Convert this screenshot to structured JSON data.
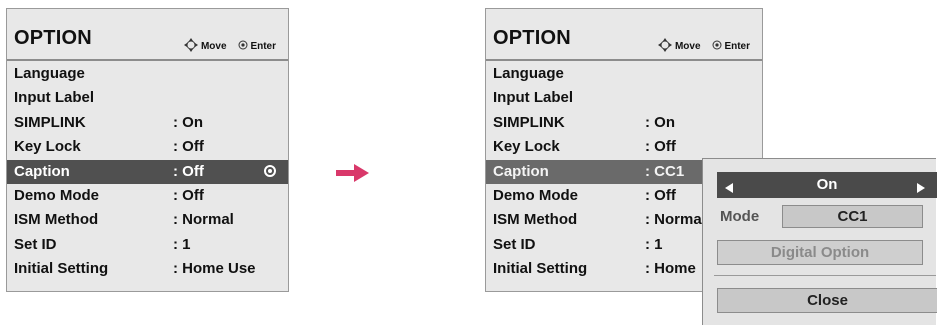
{
  "colors": {
    "panel_bg": "#e8e8e8",
    "selected_row_bg": "#505050",
    "arrow": "#d9386a",
    "popup_toggle_bg": "#4a4a4a"
  },
  "left_menu": {
    "title": "OPTION",
    "hint_move": "Move",
    "hint_enter": "Enter",
    "items": [
      {
        "name": "Language",
        "value": ""
      },
      {
        "name": "Input Label",
        "value": ""
      },
      {
        "name": "SIMPLINK",
        "value": ": On"
      },
      {
        "name": "Key Lock",
        "value": ": Off"
      },
      {
        "name": "Caption",
        "value": ": Off",
        "selected": true
      },
      {
        "name": "Demo Mode",
        "value": ": Off"
      },
      {
        "name": "ISM Method",
        "value": ": Normal"
      },
      {
        "name": "Set ID",
        "value": ": 1"
      },
      {
        "name": "Initial Setting",
        "value": ": Home Use"
      }
    ]
  },
  "right_menu": {
    "title": "OPTION",
    "hint_move": "Move",
    "hint_enter": "Enter",
    "items": [
      {
        "name": "Language",
        "value": ""
      },
      {
        "name": "Input Label",
        "value": ""
      },
      {
        "name": "SIMPLINK",
        "value": ": On"
      },
      {
        "name": "Key Lock",
        "value": ": Off"
      },
      {
        "name": "Caption",
        "value": ": CC1",
        "selected": true
      },
      {
        "name": "Demo Mode",
        "value": ": Off"
      },
      {
        "name": "ISM Method",
        "value": ": Norma"
      },
      {
        "name": "Set ID",
        "value": ": 1"
      },
      {
        "name": "Initial Setting",
        "value": ": Home"
      }
    ]
  },
  "popup": {
    "toggle_value": "On",
    "mode_label": "Mode",
    "mode_value": "CC1",
    "digital_option_label": "Digital Option",
    "close_label": "Close"
  },
  "icons": {
    "move": "four-way-arrow-icon",
    "enter": "enter-circle-icon",
    "transition": "right-arrow-icon",
    "selected_marker": "radio-selected-icon",
    "toggle_left": "triangle-left-icon",
    "toggle_right": "triangle-right-icon"
  }
}
